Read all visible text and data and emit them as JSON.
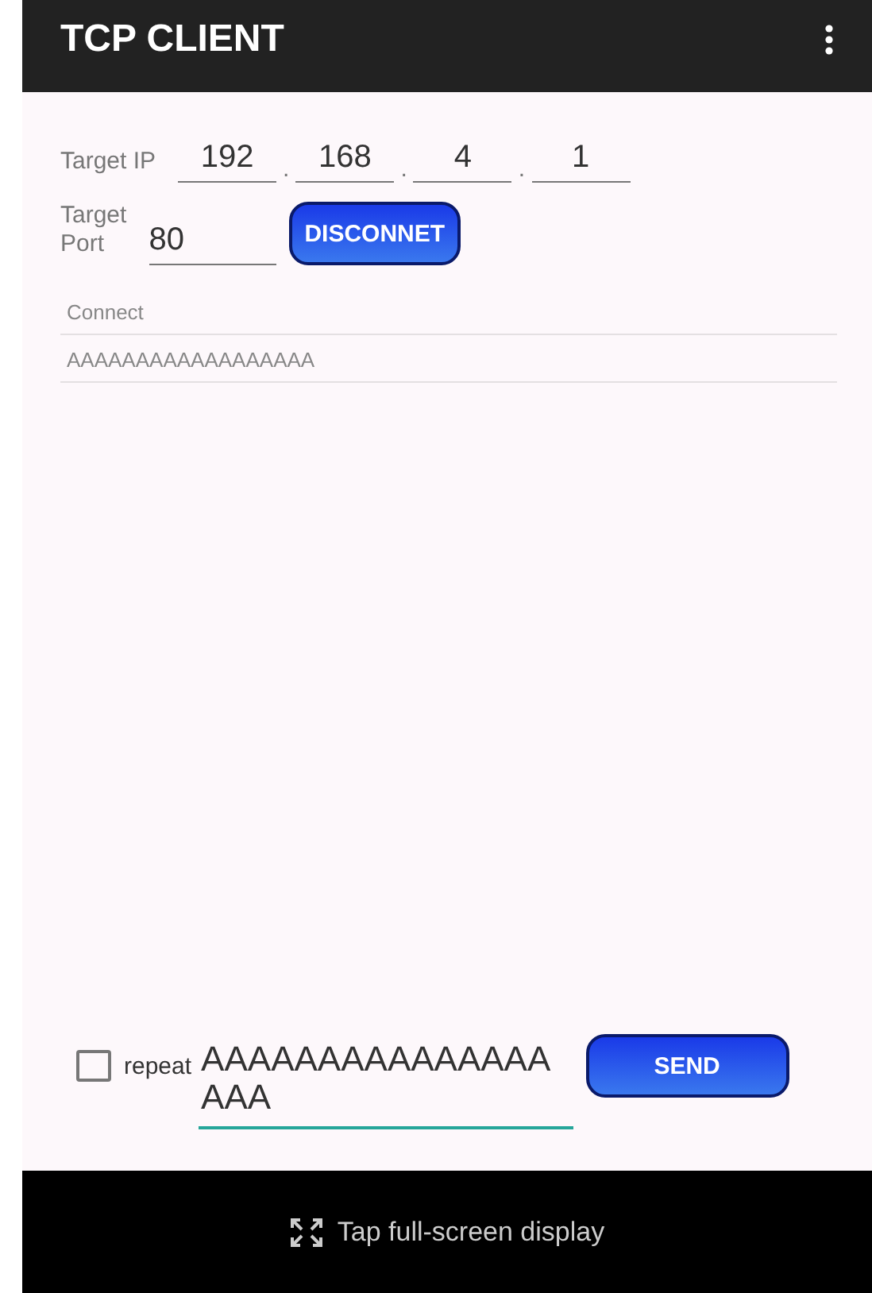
{
  "app_bar": {
    "title": "TCP CLIENT"
  },
  "target_ip": {
    "label": "Target IP",
    "octets": [
      "192",
      "168",
      "4",
      "1"
    ],
    "separator": "."
  },
  "target_port": {
    "label": "Target\nPort",
    "value": "80"
  },
  "connect_button": {
    "label": "DISCONNET"
  },
  "log": {
    "label": "Connect",
    "received": "AAAAAAAAAAAAAAAAAA"
  },
  "repeat": {
    "label": "repeat",
    "checked": false
  },
  "message": {
    "value": "AAAAAAAAAAAAAAAAAA"
  },
  "send_button": {
    "label": "SEND"
  },
  "footer": {
    "text": "Tap full-screen display"
  }
}
